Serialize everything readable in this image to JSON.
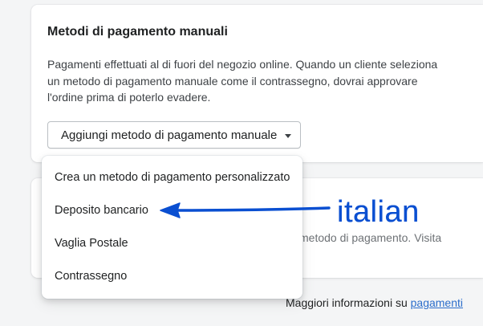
{
  "card": {
    "title": "Metodi di pagamento manuali",
    "description": "Pagamenti effettuati al di fuori del negozio online. Quando un cliente seleziona un metodo di pagamento manuale come il contrassegno, dovrai approvare l'ordine prima di poterlo evadere.",
    "add_button_label": "Aggiungi metodo di pagamento manuale"
  },
  "second_card": {
    "partial_text": "metodo di pagamento. Visita"
  },
  "dropdown": {
    "items": [
      {
        "label": "Crea un metodo di pagamento personalizzato"
      },
      {
        "label": "Deposito bancario"
      },
      {
        "label": "Vaglia Postale"
      },
      {
        "label": "Contrassegno"
      }
    ]
  },
  "footer": {
    "text": "Maggiori informazioni su ",
    "link": "pagamenti"
  },
  "annotation": {
    "label": "italian",
    "color": "#0a4fd1"
  },
  "colors": {
    "link": "#2c6ecb",
    "page_background": "#f4f5f6"
  }
}
